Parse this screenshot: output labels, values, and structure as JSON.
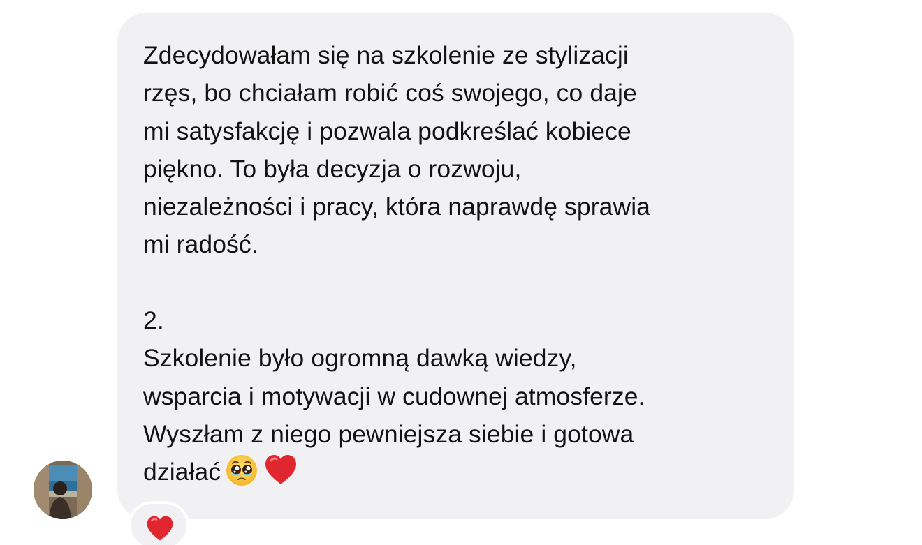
{
  "message": {
    "paragraph_1": "Zdecydowałam się na szkolenie ze stylizacji\nrzęs, bo chciałam robić coś swojego, co daje\nmi satysfakcję i pozwala podkreślać kobiece\npiękno. To była decyzja o rozwoju,\nniezależności i pracy, która naprawdę sprawia\nmi radość.",
    "section_number": "2.",
    "paragraph_2": "Szkolenie było ogromną dawką wiedzy,\nwsparcia i motywacji w cudownej atmosferze.\nWyszłam z niego pewniejsza siebie i gotowa\ndziałać",
    "trailing_emojis": [
      "pleading-face-icon",
      "red-heart-icon"
    ]
  },
  "reaction": {
    "emoji": "red-heart-icon"
  },
  "colors": {
    "bubble_bg": "#f1f1f3",
    "text": "#121212",
    "heart": "#e0262f",
    "pleading_face": "#f7c33b"
  }
}
